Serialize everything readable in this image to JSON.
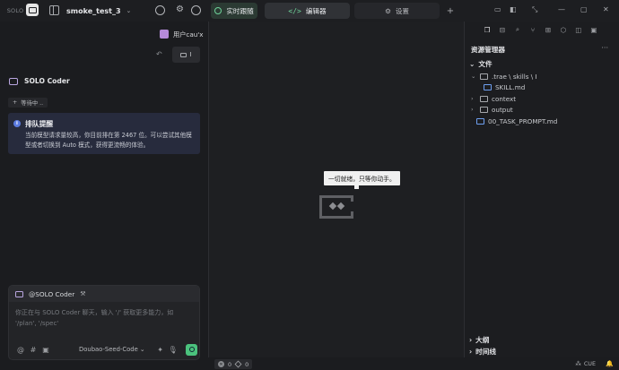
{
  "titlebar": {
    "logo_text": "SOLO",
    "project_name": "smoke_test_3",
    "tabs": [
      {
        "label": "实时跟随"
      },
      {
        "label": "编辑器"
      },
      {
        "label": "设置"
      }
    ],
    "add_tab": "+"
  },
  "chat": {
    "user_name": "用户cau'x",
    "user_chip": "I",
    "agent_name": "SOLO Coder",
    "waiting_label": "等待中 ..",
    "notice_title": "排队提醒",
    "notice_body": "当前模型请求量较高，你目前排在第 2467 位。可以尝试其他模型或者切换到 Auto 模式，获得更流畅的体验。",
    "mention": "@SOLO Coder",
    "placeholder": "你正在与 SOLO Coder 聊天，输入 '/' 获取更多能力，如 '/plan', '/spec'",
    "model": "Doubao-Seed-Code"
  },
  "editor": {
    "empty_tip": "一切就绪，只等你动手。"
  },
  "explorer": {
    "title": "资源管理器",
    "files_section": "文件",
    "tree": [
      {
        "name": ".trae \\ skills \\ I",
        "type": "folder",
        "expanded": true
      },
      {
        "name": "SKILL.md",
        "type": "markdown"
      },
      {
        "name": "context",
        "type": "folder",
        "expanded": false
      },
      {
        "name": "output",
        "type": "folder",
        "expanded": false
      },
      {
        "name": "00_TASK_PROMPT.md",
        "type": "markdown"
      }
    ],
    "outline_section": "大纲",
    "timeline_section": "时间线"
  },
  "statusbar": {
    "errors": "0",
    "warnings": "0",
    "cue": "CUE"
  },
  "colors": {
    "accent_green": "#4bc27d",
    "notice_bg": "#272b3d",
    "info_blue": "#5b7be0"
  }
}
